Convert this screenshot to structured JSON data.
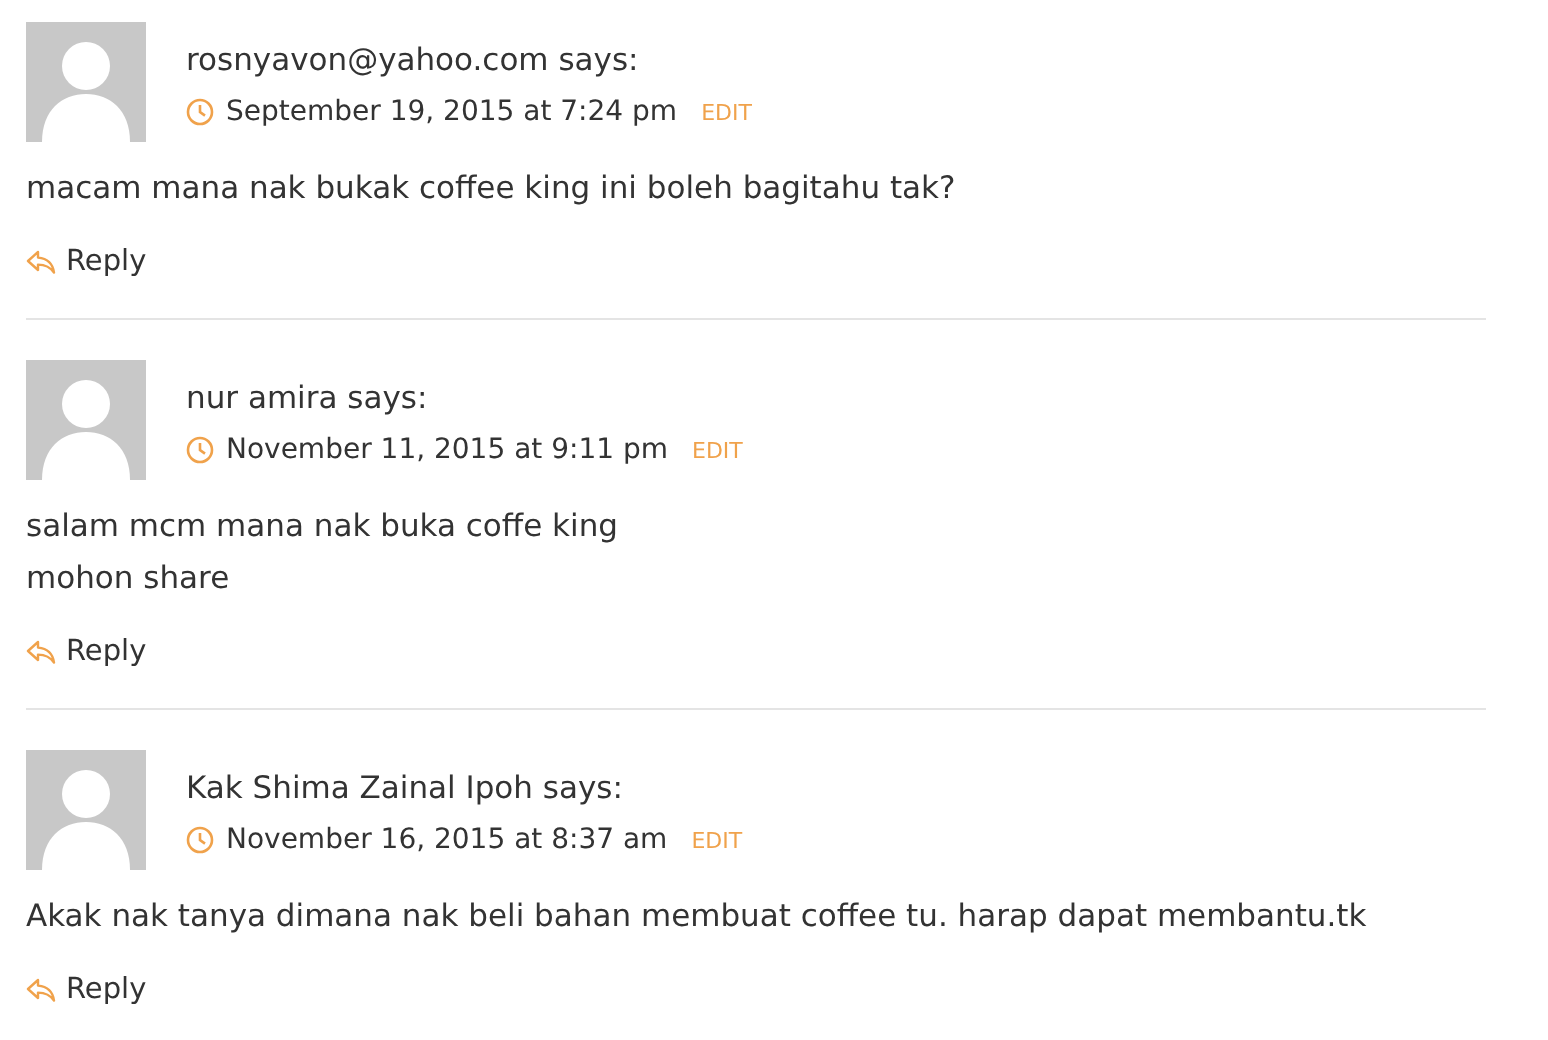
{
  "comments": [
    {
      "author": "rosnyavon@yahoo.com says:",
      "date": "September 19, 2015 at 7:24 pm",
      "edit": "EDIT",
      "lines": [
        "macam mana nak bukak coffee king ini boleh bagitahu tak?"
      ],
      "reply": "Reply"
    },
    {
      "author": "nur amira says:",
      "date": "November 11, 2015 at 9:11 pm",
      "edit": "EDIT",
      "lines": [
        "salam mcm mana nak buka coffe king",
        "mohon share"
      ],
      "reply": "Reply"
    },
    {
      "author": "Kak Shima Zainal Ipoh says:",
      "date": "November 16, 2015 at 8:37 am",
      "edit": "EDIT",
      "lines": [
        "Akak nak tanya dimana nak beli bahan membuat coffee tu. harap dapat membantu.tk"
      ],
      "reply": "Reply"
    }
  ]
}
